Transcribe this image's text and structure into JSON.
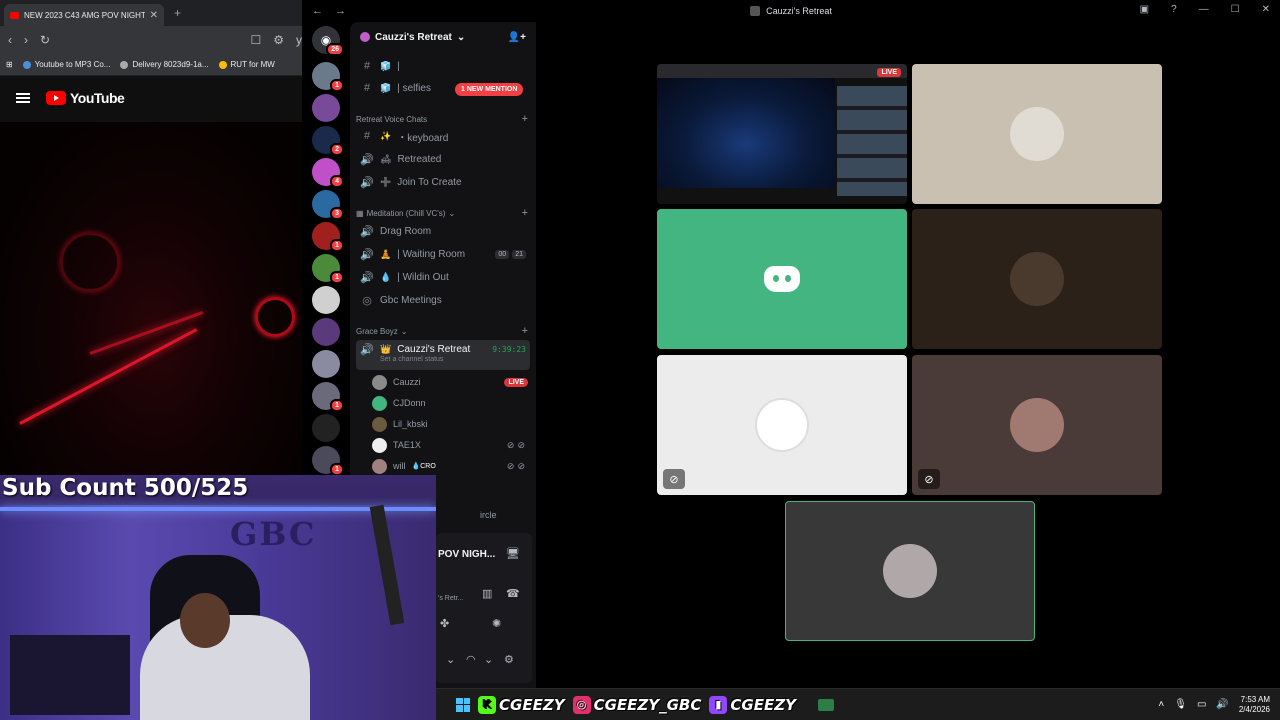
{
  "browser": {
    "tab_title": "NEW 2023 C43 AMG POV NIGHT",
    "bookmarks": [
      {
        "label": "Youtube to MP3 Co..."
      },
      {
        "label": "Delivery 8023d9-1a..."
      },
      {
        "label": "RUT for MW"
      }
    ],
    "youtube_logo": "YouTube",
    "address_partial": "y"
  },
  "webcam": {
    "sub_count": "Sub Count 500/525",
    "wall_text": "GBC"
  },
  "discord": {
    "window_title": "Cauzzi's Retreat",
    "server_name": "Cauzzi's Retreat",
    "guild_badges": [
      "26",
      "1",
      "",
      "2",
      "4",
      "3",
      "",
      "1",
      "1",
      "",
      "",
      "",
      "1",
      "",
      "1"
    ],
    "new_mention": "1 NEW MENTION",
    "channels_top": [
      {
        "label": "| selfies"
      }
    ],
    "categories": {
      "retreat_voice": "Retreat Voice Chats",
      "meditation": "Meditation (Chill VC's)",
      "grace_boyz": "Grace Boyz"
    },
    "voice_channels": [
      {
        "label": "・keyboard"
      },
      {
        "label": "Retreated"
      },
      {
        "label": "Join To Create"
      },
      {
        "label": "Drag Room"
      },
      {
        "label": "| Waiting Room",
        "count_a": "00",
        "count_b": "21"
      },
      {
        "label": "| Wildin Out"
      },
      {
        "label": "Gbc Meetings"
      }
    ],
    "active_channel": {
      "label": "Cauzzi's Retreat",
      "timer": "9:39:23",
      "status": "Set a channel status"
    },
    "voice_users": [
      {
        "name": "Cauzzi",
        "live": "LIVE"
      },
      {
        "name": "CJDonn"
      },
      {
        "name": "Lil_kbski"
      },
      {
        "name": "TAE1X"
      },
      {
        "name": "will",
        "tag": "CRO"
      }
    ],
    "partial_channel": "ircle",
    "tile_live": "LIVE",
    "panel": {
      "stream_title": "POV NIGH...",
      "channel_sub": "'s Retr..."
    }
  },
  "taskbar": {
    "social_kick": "CGEEZY",
    "social_instagram": "CGEEZY_GBC",
    "social_twitch": "CGEEZY",
    "time": "7:53 AM",
    "date": "2/4/2026"
  },
  "colors": {
    "discord_green": "#43b581",
    "live_red": "#da373c",
    "mention_red": "#f23f43",
    "kick_green": "#53fc18",
    "instagram_pink": "#e1306c",
    "twitch_purple": "#9146ff"
  }
}
